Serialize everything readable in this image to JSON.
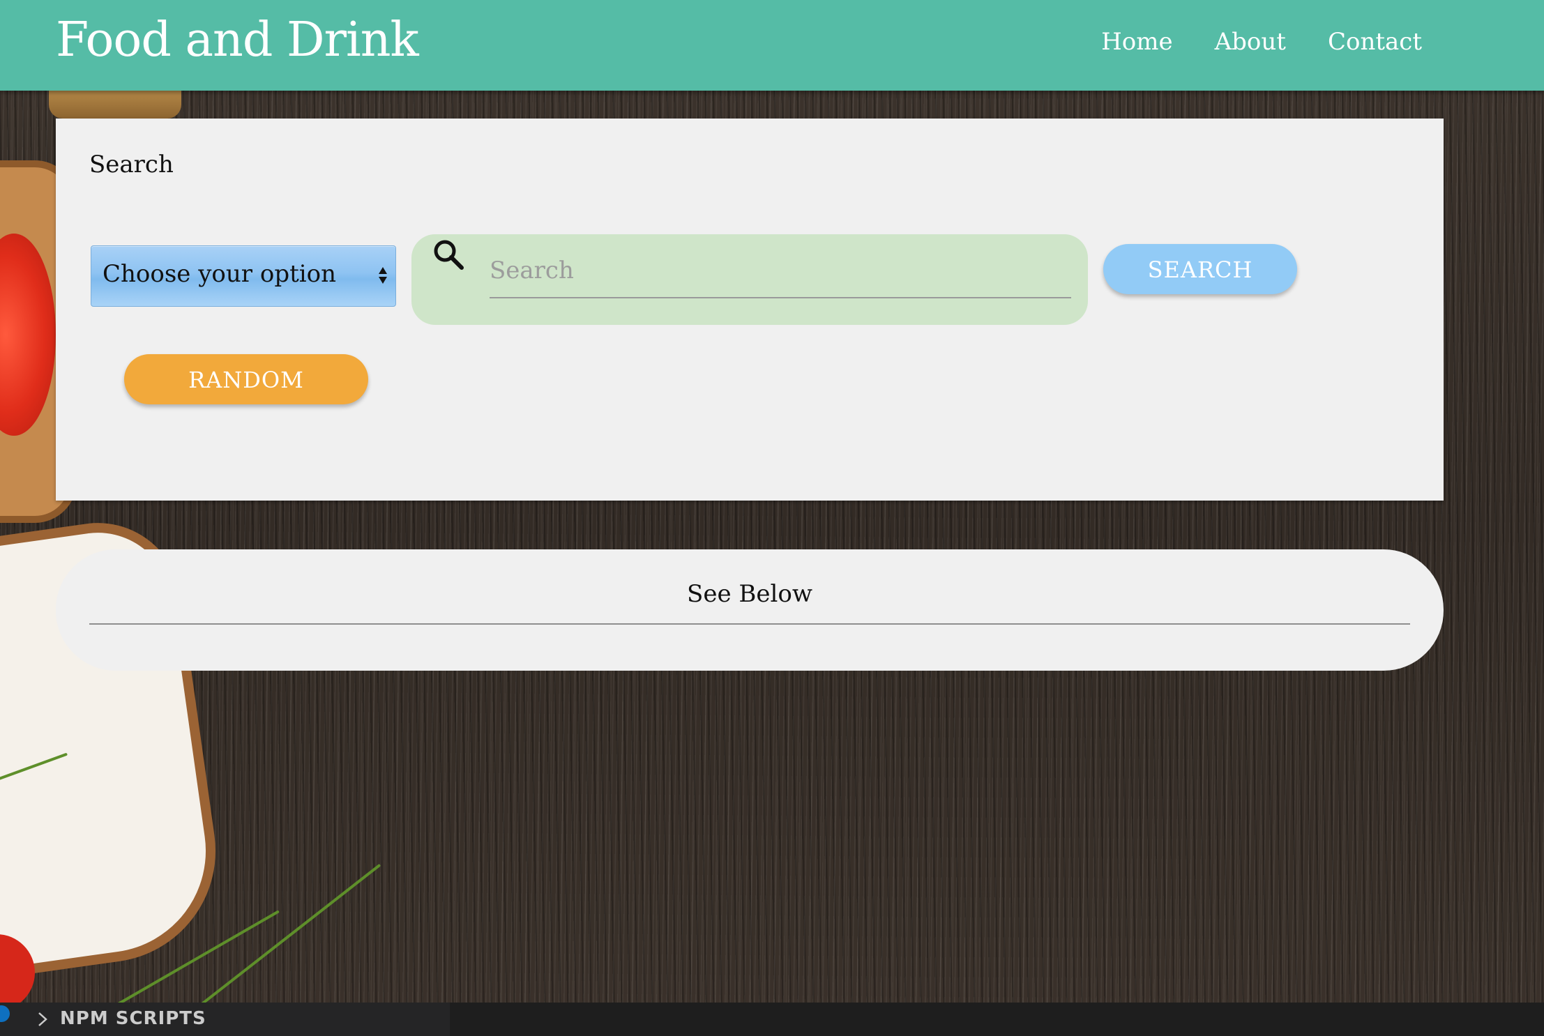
{
  "header": {
    "brand": "Food and Drink",
    "nav": [
      {
        "label": "Home"
      },
      {
        "label": "About"
      },
      {
        "label": "Contact"
      }
    ],
    "color": "#55bca6"
  },
  "search_card": {
    "title": "Search",
    "select": {
      "selected": "Choose your option"
    },
    "search_input": {
      "placeholder": "Search",
      "value": ""
    },
    "search_button_label": "SEARCH",
    "random_button_label": "RANDOM"
  },
  "results": {
    "heading": "See Below"
  },
  "statusbar": {
    "label": "NPM SCRIPTS"
  },
  "icons": {
    "search": "search-icon",
    "select_arrows": "updown-arrows-icon",
    "chevron": "chevron-right-icon"
  },
  "colors": {
    "search_button": "#92cbf6",
    "random_button": "#f2a93b",
    "search_field_bg": "#cfe5c9"
  }
}
